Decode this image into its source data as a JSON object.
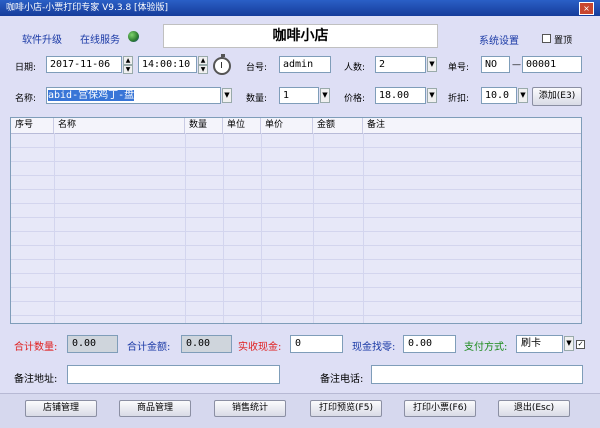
{
  "window": {
    "title": "咖啡小店-小票打印专家 V9.3.8 [体验版]",
    "close_glyph": "×"
  },
  "toolbar": {
    "upgrade": "软件升级",
    "service": "在线服务",
    "settings": "系统设置",
    "topmost": "置顶"
  },
  "store": {
    "name": "咖啡小店"
  },
  "form": {
    "date_label": "日期:",
    "date": "2017-11-06",
    "time": "14:00:10",
    "table_label": "台号:",
    "table": "admin",
    "people_label": "人数:",
    "people": "2",
    "order_label": "单号:",
    "order_prefix": "NO",
    "order_dash": "—",
    "order_no": "00001",
    "name_label": "名称:",
    "name": "abid-宫保鸡丁-盘",
    "qty_label": "数量:",
    "qty": "1",
    "price_label": "价格:",
    "price": "18.00",
    "discount_label": "折扣:",
    "discount": "10.0",
    "add_button": "添加(E3)"
  },
  "grid": {
    "columns": [
      "序号",
      "名称",
      "数量",
      "单位",
      "单价",
      "金额",
      "备注"
    ],
    "rows": []
  },
  "summary": {
    "total_qty_label": "合计数量:",
    "total_qty": "0.00",
    "total_amount_label": "合计金额:",
    "total_amount": "0.00",
    "received_label": "实收现金:",
    "received": "0",
    "change_label": "现金找零:",
    "change": "0.00",
    "payment_label": "支付方式:",
    "payment": "刷卡",
    "address_label": "备注地址:",
    "address": "",
    "phone_label": "备注电话:",
    "phone": ""
  },
  "buttons": {
    "store_mgmt": "店铺管理",
    "goods_mgmt": "商品管理",
    "sales_stats": "销售统计",
    "print_preview": "打印预览(F5)",
    "print_ticket": "打印小票(F6)",
    "exit": "退出(Esc)"
  },
  "icons": {
    "spin_up": "▲",
    "spin_down": "▼",
    "dropdown": "▼",
    "check": "✓"
  },
  "colors": {
    "red_label": "#e02020",
    "blue_label": "#1b3aa6",
    "green_label": "#1a8a1a",
    "name_highlight": "#3875d7"
  }
}
